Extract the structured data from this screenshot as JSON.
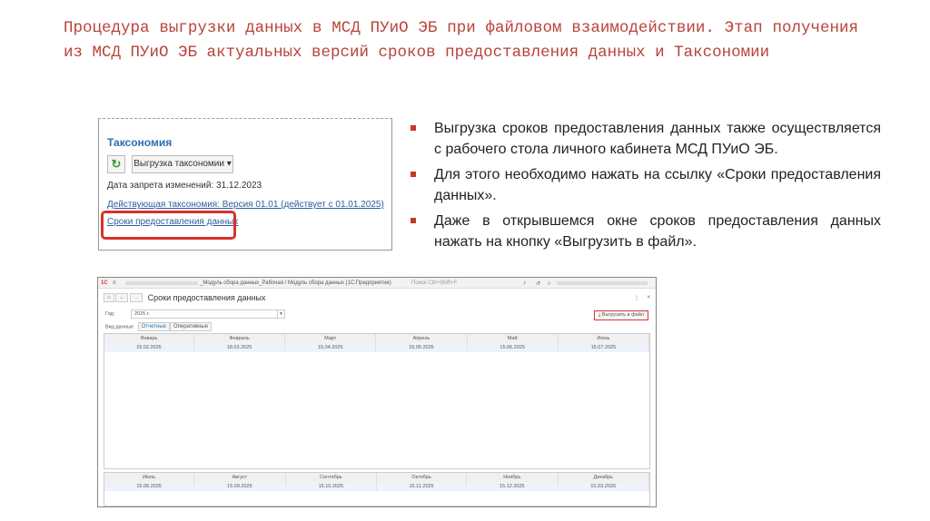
{
  "title": "Процедура выгрузки данных в МСД ПУиО ЭБ при файловом взаимодействии. Этап получения из МСД ПУиО ЭБ актуальных версий сроков предоставления данных и Таксономии",
  "taxonomy": {
    "heading": "Таксономия",
    "export_button": "Выгрузка таксономии",
    "ban_date": "Дата запрета изменений:  31.12.2023",
    "current_link": "Действующая таксономия: Версия 01.01 (действует с 01.01.2025)",
    "deadlines_link": "Сроки предоставления данных"
  },
  "bullets": [
    "Выгрузка сроков предоставления данных также осуществляется с рабочего стола личного кабинета МСД ПУиО ЭБ.",
    "Для этого необходимо нажать на ссылку «Сроки предоставления данных».",
    "Даже в открывшемся окне сроков предоставления данных нажать на кнопку «Выгрузить в файл»."
  ],
  "window": {
    "logo": "1С",
    "caption": "_Модуль сбора данных_Рабочая / Модуль сбора данных  (1С:Предприятие)",
    "search_placeholder": "Поиск Ctrl+Shift+F",
    "form_title": "Сроки предоставления данных",
    "year_label": "Год:",
    "year_value": "2025 г.",
    "export_button": "Выгрузить в файл",
    "data_type_label": "Вид данных:",
    "tabs": [
      "Отчетные",
      "Оперативные"
    ],
    "table1": {
      "headers": [
        "Январь",
        "Февраль",
        "Март",
        "Апрель",
        "Май",
        "Июнь"
      ],
      "values": [
        "15.02.2025",
        "18.03.2025",
        "15.04.2025",
        "15.05.2025",
        "15.06.2025",
        "15.07.2025"
      ]
    },
    "table2": {
      "headers": [
        "Июль",
        "Август",
        "Сентябрь",
        "Октябрь",
        "Ноябрь",
        "Декабрь"
      ],
      "values": [
        "15.08.2025",
        "15.09.2025",
        "15.10.2025",
        "15.11.2025",
        "15.12.2025",
        "01.03.2026"
      ]
    }
  }
}
